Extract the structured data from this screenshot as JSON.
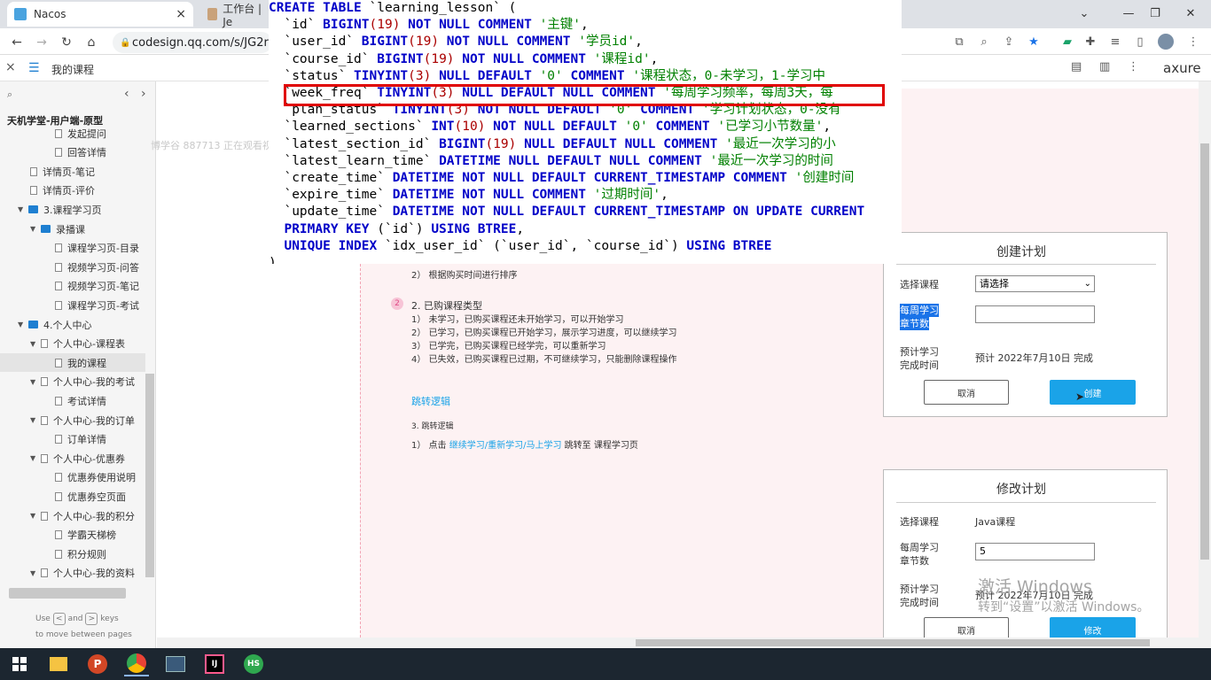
{
  "browser": {
    "tabs": [
      {
        "title": "Nacos",
        "close": "×"
      },
      {
        "title": "工作台 | Je",
        "close": "×"
      }
    ],
    "window_controls": [
      "⌄",
      "—",
      "❐",
      "✕"
    ],
    "url": "codesign.qq.com/s/JG2r"
  },
  "axure": {
    "close": "×",
    "page_title": "我的课程",
    "logo": "axure",
    "project": "天机学堂-用户端-原型",
    "nav_prev": "‹",
    "nav_next": "›"
  },
  "sidebar": {
    "items": [
      {
        "label": "发起提问",
        "type": "doc",
        "level": 3
      },
      {
        "label": "回答详情",
        "type": "doc",
        "level": 3
      },
      {
        "label": "详情页-笔记",
        "type": "doc",
        "level": 2
      },
      {
        "label": "详情页-评价",
        "type": "doc",
        "level": 2
      },
      {
        "label": "3.课程学习页",
        "type": "folder",
        "level": 1
      },
      {
        "label": "录播课",
        "type": "folder",
        "level": 2
      },
      {
        "label": "课程学习页-目录",
        "type": "doc",
        "level": 3
      },
      {
        "label": "视频学习页-问答",
        "type": "doc",
        "level": 3
      },
      {
        "label": "视频学习页-笔记",
        "type": "doc",
        "level": 3
      },
      {
        "label": "课程学习页-考试",
        "type": "doc",
        "level": 3
      },
      {
        "label": "4.个人中心",
        "type": "folder",
        "level": 1
      },
      {
        "label": "个人中心-课程表",
        "type": "docfold",
        "level": 2
      },
      {
        "label": "我的课程",
        "type": "doc",
        "level": 3,
        "selected": true
      },
      {
        "label": "个人中心-我的考试",
        "type": "docfold",
        "level": 2
      },
      {
        "label": "考试详情",
        "type": "doc",
        "level": 3
      },
      {
        "label": "个人中心-我的订单",
        "type": "docfold",
        "level": 2
      },
      {
        "label": "订单详情",
        "type": "doc",
        "level": 3
      },
      {
        "label": "个人中心-优惠券",
        "type": "docfold",
        "level": 2
      },
      {
        "label": "优惠券使用说明",
        "type": "doc",
        "level": 3
      },
      {
        "label": "优惠券空页面",
        "type": "doc",
        "level": 3
      },
      {
        "label": "个人中心-我的积分",
        "type": "docfold",
        "level": 2
      },
      {
        "label": "学霸天梯榜",
        "type": "doc",
        "level": 3
      },
      {
        "label": "积分规则",
        "type": "doc",
        "level": 3
      },
      {
        "label": "个人中心-我的资料",
        "type": "docfold",
        "level": 2
      }
    ],
    "hint_use": "Use",
    "hint_and": "and",
    "hint_keys": "keys",
    "hint_line2": "to move between pages"
  },
  "viewer_overlay": "博学谷 887713 正在观看视频",
  "sql": {
    "lines": [
      [
        [
          "kw",
          "CREATE TABLE "
        ],
        [
          "id",
          "`learning_lesson` ("
        ]
      ],
      [
        [
          "id",
          "  `id` "
        ],
        [
          "kw",
          "BIGINT"
        ],
        [
          "num",
          "(19)"
        ],
        [
          "kw",
          " NOT NULL COMMENT "
        ],
        [
          "str",
          "'主键'"
        ],
        [
          "id",
          ","
        ]
      ],
      [
        [
          "id",
          "  `user_id` "
        ],
        [
          "kw",
          "BIGINT"
        ],
        [
          "num",
          "(19)"
        ],
        [
          "kw",
          " NOT NULL COMMENT "
        ],
        [
          "str",
          "'学员id'"
        ],
        [
          "id",
          ","
        ]
      ],
      [
        [
          "id",
          "  `course_id` "
        ],
        [
          "kw",
          "BIGINT"
        ],
        [
          "num",
          "(19)"
        ],
        [
          "kw",
          " NOT NULL COMMENT "
        ],
        [
          "str",
          "'课程id'"
        ],
        [
          "id",
          ","
        ]
      ],
      [
        [
          "id",
          "  `status` "
        ],
        [
          "kw",
          "TINYINT"
        ],
        [
          "num",
          "(3)"
        ],
        [
          "kw",
          " NULL DEFAULT "
        ],
        [
          "str",
          "'0'"
        ],
        [
          "kw",
          " COMMENT "
        ],
        [
          "str",
          "'课程状态，0-未学习，1-学习中"
        ]
      ],
      [
        [
          "id",
          "  `week_freq` "
        ],
        [
          "kw",
          "TINYINT"
        ],
        [
          "num",
          "(3)"
        ],
        [
          "kw",
          " NULL DEFAULT NULL COMMENT "
        ],
        [
          "str",
          "'每周学习频率，每周3天，每"
        ]
      ],
      [
        [
          "id",
          "  `plan_status` "
        ],
        [
          "kw",
          "TINYINT"
        ],
        [
          "num",
          "(3)"
        ],
        [
          "kw",
          " NOT NULL DEFAULT "
        ],
        [
          "str",
          "'0'"
        ],
        [
          "kw",
          " COMMENT "
        ],
        [
          "str",
          "'学习计划状态，0-没有"
        ]
      ],
      [
        [
          "id",
          "  `learned_sections` "
        ],
        [
          "kw",
          "INT"
        ],
        [
          "num",
          "(10)"
        ],
        [
          "kw",
          " NOT NULL DEFAULT "
        ],
        [
          "str",
          "'0'"
        ],
        [
          "kw",
          " COMMENT "
        ],
        [
          "str",
          "'已学习小节数量'"
        ],
        [
          "id",
          ","
        ]
      ],
      [
        [
          "id",
          "  `latest_section_id` "
        ],
        [
          "kw",
          "BIGINT"
        ],
        [
          "num",
          "(19)"
        ],
        [
          "kw",
          " NULL DEFAULT NULL COMMENT "
        ],
        [
          "str",
          "'最近一次学习的小"
        ]
      ],
      [
        [
          "id",
          "  `latest_learn_time` "
        ],
        [
          "kw",
          "DATETIME"
        ],
        [
          "kw",
          " NULL DEFAULT NULL COMMENT "
        ],
        [
          "str",
          "'最近一次学习的时间"
        ]
      ],
      [
        [
          "id",
          "  `create_time` "
        ],
        [
          "kw",
          "DATETIME"
        ],
        [
          "kw",
          " NOT NULL DEFAULT CURRENT_TIMESTAMP COMMENT "
        ],
        [
          "str",
          "'创建时间"
        ]
      ],
      [
        [
          "id",
          "  `expire_time` "
        ],
        [
          "kw",
          "DATETIME"
        ],
        [
          "kw",
          " NOT NULL COMMENT "
        ],
        [
          "str",
          "'过期时间'"
        ],
        [
          "id",
          ","
        ]
      ],
      [
        [
          "id",
          "  `update_time` "
        ],
        [
          "kw",
          "DATETIME"
        ],
        [
          "kw",
          " NOT NULL DEFAULT CURRENT_TIMESTAMP ON UPDATE CURRENT"
        ]
      ],
      [
        [
          "kw",
          "  PRIMARY KEY "
        ],
        [
          "id",
          "(`id`) "
        ],
        [
          "kw",
          "USING BTREE"
        ],
        [
          "id",
          ","
        ]
      ],
      [
        [
          "kw",
          "  UNIQUE INDEX "
        ],
        [
          "id",
          "`idx_user_id` (`user_id`, `course_id`) "
        ],
        [
          "kw",
          "USING BTREE"
        ]
      ],
      [
        [
          "id",
          ")"
        ]
      ]
    ]
  },
  "notes": {
    "sort_item": "2）  根据购买时间进行排序",
    "section2_badge": "2",
    "section2_title": "2. 已购课程类型",
    "section2_items": [
      "1）  未学习，已购买课程还未开始学习，可以开始学习",
      "2）  已学习，已购买课程已开始学习，展示学习进度，可以继续学习",
      "3）  已学完，已购买课程已经学完，可以重新学习",
      "4）  已失效，已购买课程已过期，不可继续学习，只能删除课程操作"
    ],
    "jump_link": "跳转逻辑",
    "section3_title": "3. 跳转逻辑",
    "section3_item_prefix": "1）  点击",
    "section3_link": "继续学习/重新学习/马上学习",
    "section3_item_suffix": "跳转至 课程学习页"
  },
  "create_plan": {
    "title": "创建计划",
    "course_label": "选择课程",
    "course_select": "请选择",
    "freq_label_1": "每周学习",
    "freq_label_2": "章节数",
    "freq_value": "",
    "eta_label_1": "预计学习",
    "eta_label_2": "完成时间",
    "eta_value": "预计 2022年7月10日 完成",
    "cancel": "取消",
    "confirm": "创建"
  },
  "edit_plan": {
    "title": "修改计划",
    "course_label": "选择课程",
    "course_value": "Java课程",
    "freq_label_1": "每周学习",
    "freq_label_2": "章节数",
    "freq_value": "5",
    "eta_label_1": "预计学习",
    "eta_label_2": "完成时间",
    "eta_value": "预计 2022年7月10日 完成",
    "cancel": "取消",
    "confirm": "修改"
  },
  "windows_watermark": {
    "line1": "激活 Windows",
    "line2": "转到“设置”以激活 Windows。"
  },
  "colors": {
    "sql_keyword": "#0000c8",
    "sql_string": "#008000",
    "sql_number": "#aa0000",
    "highlight_box": "#e00000",
    "axure_blue": "#1aa3e8"
  }
}
